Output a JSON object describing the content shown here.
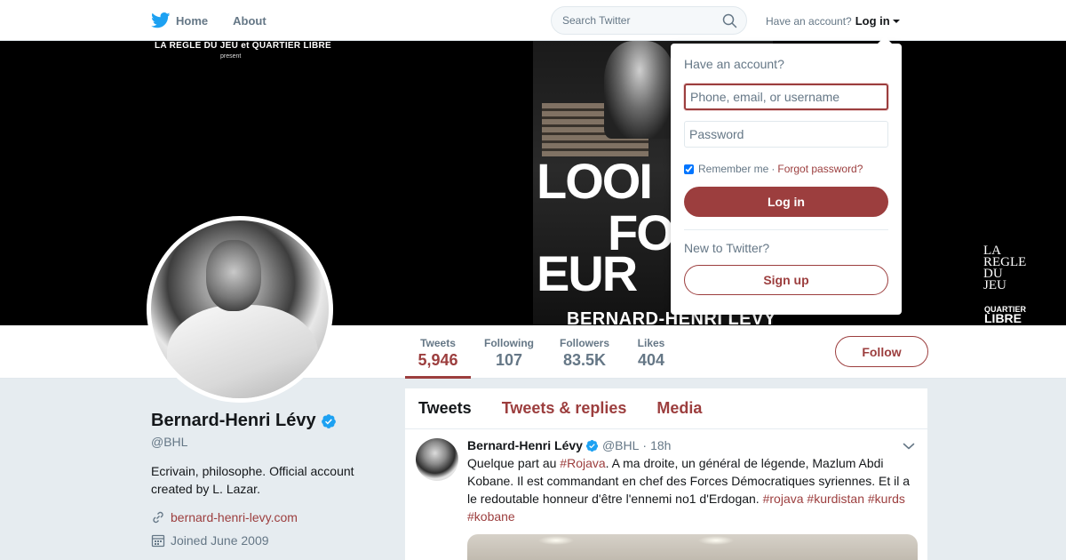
{
  "nav": {
    "home_label": "Home",
    "about_label": "About",
    "search_placeholder": "Search Twitter",
    "have_account": "Have an account?",
    "login_label": "Log in"
  },
  "banner": {
    "topline": "LA REGLE DU JEU et QUARTIER LIBRE",
    "present": "present",
    "poster_line1": "LOOI",
    "poster_line2": "FO",
    "poster_line3": "EUR",
    "poster_author": "BERNARD-HENRI LEVY",
    "logo_regle": [
      "LA",
      "REGLE",
      "DU",
      "JEU"
    ],
    "logo_quartier": "QUARTIER",
    "logo_libre": "LIBRE"
  },
  "stats": [
    {
      "label": "Tweets",
      "value": "5,946",
      "active": true
    },
    {
      "label": "Following",
      "value": "107",
      "active": false
    },
    {
      "label": "Followers",
      "value": "83.5K",
      "active": false
    },
    {
      "label": "Likes",
      "value": "404",
      "active": false
    }
  ],
  "follow_label": "Follow",
  "profile": {
    "name": "Bernard-Henri Lévy",
    "handle": "@BHL",
    "bio": "Ecrivain, philosophe. Official account created by L. Lazar.",
    "website": "bernard-henri-levy.com",
    "joined": "Joined June 2009"
  },
  "timeline": {
    "tabs": [
      "Tweets",
      "Tweets & replies",
      "Media"
    ]
  },
  "tweet": {
    "name": "Bernard-Henri Lévy",
    "handle": "@BHL",
    "dot": "·",
    "time": "18h",
    "text_a": "Quelque part au ",
    "tag_rojava_cap": "#Rojava",
    "text_b": ". A ma droite, un général de légende, Mazlum Abdi Kobane. Il est commandant en chef des Forces Démocratiques syriennes. Et il a le redoutable honneur d'être l'ennemi no1 d'Erdogan. ",
    "tag_rojava": "#rojava",
    "tag_kurdistan": "#kurdistan",
    "tag_kurds": "#kurds",
    "tag_kobane": "#kobane"
  },
  "login_dropdown": {
    "title": "Have an account?",
    "username_placeholder": "Phone, email, or username",
    "password_placeholder": "Password",
    "remember_label": "Remember me",
    "separator": "·",
    "forgot_label": "Forgot password?",
    "login_button": "Log in",
    "new_label": "New to Twitter?",
    "signup_button": "Sign up"
  },
  "colors": {
    "accent": "#9c3e3e",
    "verified": "#1da1f2",
    "twitter_blue": "#1da1f2",
    "page_bg": "#e6ecf0"
  },
  "icons": [
    "twitter-bird-icon",
    "home-icon",
    "search-icon",
    "caret-down-icon",
    "verified-badge-icon",
    "link-icon",
    "calendar-icon",
    "chevron-down-icon"
  ]
}
